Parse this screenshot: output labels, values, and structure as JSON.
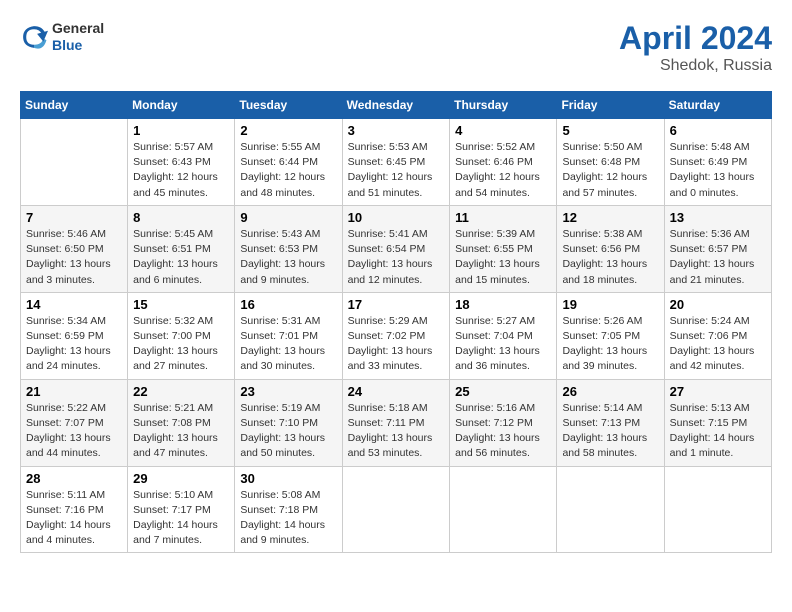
{
  "logo": {
    "line1": "General",
    "line2": "Blue"
  },
  "title": "April 2024",
  "subtitle": "Shedok, Russia",
  "days_of_week": [
    "Sunday",
    "Monday",
    "Tuesday",
    "Wednesday",
    "Thursday",
    "Friday",
    "Saturday"
  ],
  "weeks": [
    [
      {
        "day": "",
        "info": ""
      },
      {
        "day": "1",
        "info": "Sunrise: 5:57 AM\nSunset: 6:43 PM\nDaylight: 12 hours\nand 45 minutes."
      },
      {
        "day": "2",
        "info": "Sunrise: 5:55 AM\nSunset: 6:44 PM\nDaylight: 12 hours\nand 48 minutes."
      },
      {
        "day": "3",
        "info": "Sunrise: 5:53 AM\nSunset: 6:45 PM\nDaylight: 12 hours\nand 51 minutes."
      },
      {
        "day": "4",
        "info": "Sunrise: 5:52 AM\nSunset: 6:46 PM\nDaylight: 12 hours\nand 54 minutes."
      },
      {
        "day": "5",
        "info": "Sunrise: 5:50 AM\nSunset: 6:48 PM\nDaylight: 12 hours\nand 57 minutes."
      },
      {
        "day": "6",
        "info": "Sunrise: 5:48 AM\nSunset: 6:49 PM\nDaylight: 13 hours\nand 0 minutes."
      }
    ],
    [
      {
        "day": "7",
        "info": "Sunrise: 5:46 AM\nSunset: 6:50 PM\nDaylight: 13 hours\nand 3 minutes."
      },
      {
        "day": "8",
        "info": "Sunrise: 5:45 AM\nSunset: 6:51 PM\nDaylight: 13 hours\nand 6 minutes."
      },
      {
        "day": "9",
        "info": "Sunrise: 5:43 AM\nSunset: 6:53 PM\nDaylight: 13 hours\nand 9 minutes."
      },
      {
        "day": "10",
        "info": "Sunrise: 5:41 AM\nSunset: 6:54 PM\nDaylight: 13 hours\nand 12 minutes."
      },
      {
        "day": "11",
        "info": "Sunrise: 5:39 AM\nSunset: 6:55 PM\nDaylight: 13 hours\nand 15 minutes."
      },
      {
        "day": "12",
        "info": "Sunrise: 5:38 AM\nSunset: 6:56 PM\nDaylight: 13 hours\nand 18 minutes."
      },
      {
        "day": "13",
        "info": "Sunrise: 5:36 AM\nSunset: 6:57 PM\nDaylight: 13 hours\nand 21 minutes."
      }
    ],
    [
      {
        "day": "14",
        "info": "Sunrise: 5:34 AM\nSunset: 6:59 PM\nDaylight: 13 hours\nand 24 minutes."
      },
      {
        "day": "15",
        "info": "Sunrise: 5:32 AM\nSunset: 7:00 PM\nDaylight: 13 hours\nand 27 minutes."
      },
      {
        "day": "16",
        "info": "Sunrise: 5:31 AM\nSunset: 7:01 PM\nDaylight: 13 hours\nand 30 minutes."
      },
      {
        "day": "17",
        "info": "Sunrise: 5:29 AM\nSunset: 7:02 PM\nDaylight: 13 hours\nand 33 minutes."
      },
      {
        "day": "18",
        "info": "Sunrise: 5:27 AM\nSunset: 7:04 PM\nDaylight: 13 hours\nand 36 minutes."
      },
      {
        "day": "19",
        "info": "Sunrise: 5:26 AM\nSunset: 7:05 PM\nDaylight: 13 hours\nand 39 minutes."
      },
      {
        "day": "20",
        "info": "Sunrise: 5:24 AM\nSunset: 7:06 PM\nDaylight: 13 hours\nand 42 minutes."
      }
    ],
    [
      {
        "day": "21",
        "info": "Sunrise: 5:22 AM\nSunset: 7:07 PM\nDaylight: 13 hours\nand 44 minutes."
      },
      {
        "day": "22",
        "info": "Sunrise: 5:21 AM\nSunset: 7:08 PM\nDaylight: 13 hours\nand 47 minutes."
      },
      {
        "day": "23",
        "info": "Sunrise: 5:19 AM\nSunset: 7:10 PM\nDaylight: 13 hours\nand 50 minutes."
      },
      {
        "day": "24",
        "info": "Sunrise: 5:18 AM\nSunset: 7:11 PM\nDaylight: 13 hours\nand 53 minutes."
      },
      {
        "day": "25",
        "info": "Sunrise: 5:16 AM\nSunset: 7:12 PM\nDaylight: 13 hours\nand 56 minutes."
      },
      {
        "day": "26",
        "info": "Sunrise: 5:14 AM\nSunset: 7:13 PM\nDaylight: 13 hours\nand 58 minutes."
      },
      {
        "day": "27",
        "info": "Sunrise: 5:13 AM\nSunset: 7:15 PM\nDaylight: 14 hours\nand 1 minute."
      }
    ],
    [
      {
        "day": "28",
        "info": "Sunrise: 5:11 AM\nSunset: 7:16 PM\nDaylight: 14 hours\nand 4 minutes."
      },
      {
        "day": "29",
        "info": "Sunrise: 5:10 AM\nSunset: 7:17 PM\nDaylight: 14 hours\nand 7 minutes."
      },
      {
        "day": "30",
        "info": "Sunrise: 5:08 AM\nSunset: 7:18 PM\nDaylight: 14 hours\nand 9 minutes."
      },
      {
        "day": "",
        "info": ""
      },
      {
        "day": "",
        "info": ""
      },
      {
        "day": "",
        "info": ""
      },
      {
        "day": "",
        "info": ""
      }
    ]
  ]
}
